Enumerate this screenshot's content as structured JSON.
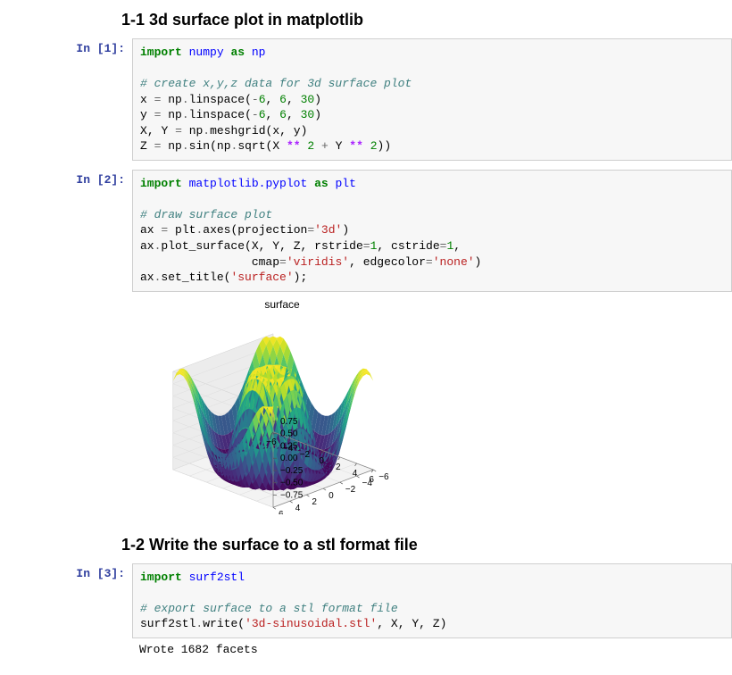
{
  "headings": {
    "sec1_1": "1-1 3d surface plot in matplotlib",
    "sec1_2": "1-2 Write the surface to a stl format file"
  },
  "cells": {
    "c1": {
      "prompt": "In [1]:"
    },
    "c2": {
      "prompt": "In [2]:"
    },
    "c3": {
      "prompt": "In [3]:"
    }
  },
  "code1": {
    "t0": "import",
    "t1": "numpy",
    "t2": "as",
    "t3": "np",
    "c": "# create x,y,z data for 3d surface plot",
    "l1a": "x",
    "l1b": "=",
    "l1c": "np",
    "l1d": ".",
    "l1e": "linspace",
    "l1f": "(",
    "l1g": "-",
    "l1h": "6",
    "l1i": ",",
    "l1j": "6",
    "l1k": ",",
    "l1l": "30",
    "l1m": ")",
    "l2a": "y",
    "l2b": "=",
    "l2c": "np",
    "l2d": ".",
    "l2e": "linspace",
    "l2f": "(",
    "l2g": "-",
    "l2h": "6",
    "l2i": ",",
    "l2j": "6",
    "l2k": ",",
    "l2l": "30",
    "l2m": ")",
    "l3a": "X",
    "l3b": ",",
    "l3c": "Y",
    "l3d": "=",
    "l3e": "np",
    "l3f": ".",
    "l3g": "meshgrid",
    "l3h": "(",
    "l3i": "x",
    "l3j": ",",
    "l3k": "y",
    "l3l": ")",
    "l4a": "Z",
    "l4b": "=",
    "l4c": "np",
    "l4d": ".",
    "l4e": "sin",
    "l4f": "(",
    "l4g": "np",
    "l4h": ".",
    "l4i": "sqrt",
    "l4j": "(",
    "l4k": "X",
    "l4l": "**",
    "l4m": "2",
    "l4n": "+",
    "l4o": "Y",
    "l4p": "**",
    "l4q": "2",
    "l4r": ")",
    "l4s": ")"
  },
  "code2": {
    "t0": "import",
    "t1": "matplotlib.pyplot",
    "t2": "as",
    "t3": "plt",
    "c": "# draw surface plot",
    "l1a": "ax",
    "l1b": "=",
    "l1c": "plt",
    "l1d": ".",
    "l1e": "axes",
    "l1f": "(",
    "l1g": "projection",
    "l1h": "=",
    "l1i": "'3d'",
    "l1j": ")",
    "l2a": "ax",
    "l2b": ".",
    "l2c": "plot_surface",
    "l2d": "(",
    "l2e": "X",
    "l2f": ",",
    "l2g": "Y",
    "l2h": ",",
    "l2i": "Z",
    "l2j": ",",
    "l2k": "rstride",
    "l2l": "=",
    "l2m": "1",
    "l2n": ",",
    "l2o": "cstride",
    "l2p": "=",
    "l2q": "1",
    "l2r": ",",
    "l3a": "cmap",
    "l3b": "=",
    "l3c": "'viridis'",
    "l3d": ",",
    "l3e": "edgecolor",
    "l3f": "=",
    "l3g": "'none'",
    "l3h": ")",
    "l4a": "ax",
    "l4b": ".",
    "l4c": "set_title",
    "l4d": "(",
    "l4e": "'surface'",
    "l4f": ")",
    "l4g": ";"
  },
  "code3": {
    "t0": "import",
    "t1": "surf2stl",
    "c": "# export surface to a stl format file",
    "l1a": "surf2stl",
    "l1b": ".",
    "l1c": "write",
    "l1d": "(",
    "l1e": "'3d-sinusoidal.stl'",
    "l1f": ",",
    "l1g": "X",
    "l1h": ",",
    "l1i": "Y",
    "l1j": ",",
    "l1k": "Z",
    "l1l": ")"
  },
  "output3": "Wrote 1682 facets",
  "chart_data": {
    "type": "3d-surface",
    "title": "surface",
    "x_range": [
      -6,
      6
    ],
    "y_range": [
      -6,
      6
    ],
    "z_range": [
      -1,
      1
    ],
    "n_x": 30,
    "n_y": 30,
    "function": "Z = sin(sqrt(X**2 + Y**2))",
    "colormap": "viridis",
    "x_ticks": [
      -6,
      -4,
      -2,
      0,
      2,
      4,
      6
    ],
    "y_ticks": [
      -6,
      -4,
      -2,
      0,
      2,
      4,
      6
    ],
    "z_ticks": [
      -0.75,
      -0.5,
      -0.25,
      0.0,
      0.25,
      0.5,
      0.75
    ],
    "z_tick_labels": [
      "−0.75",
      "−0.50",
      "−0.25",
      "0.00",
      "0.25",
      "0.50",
      "0.75"
    ]
  }
}
